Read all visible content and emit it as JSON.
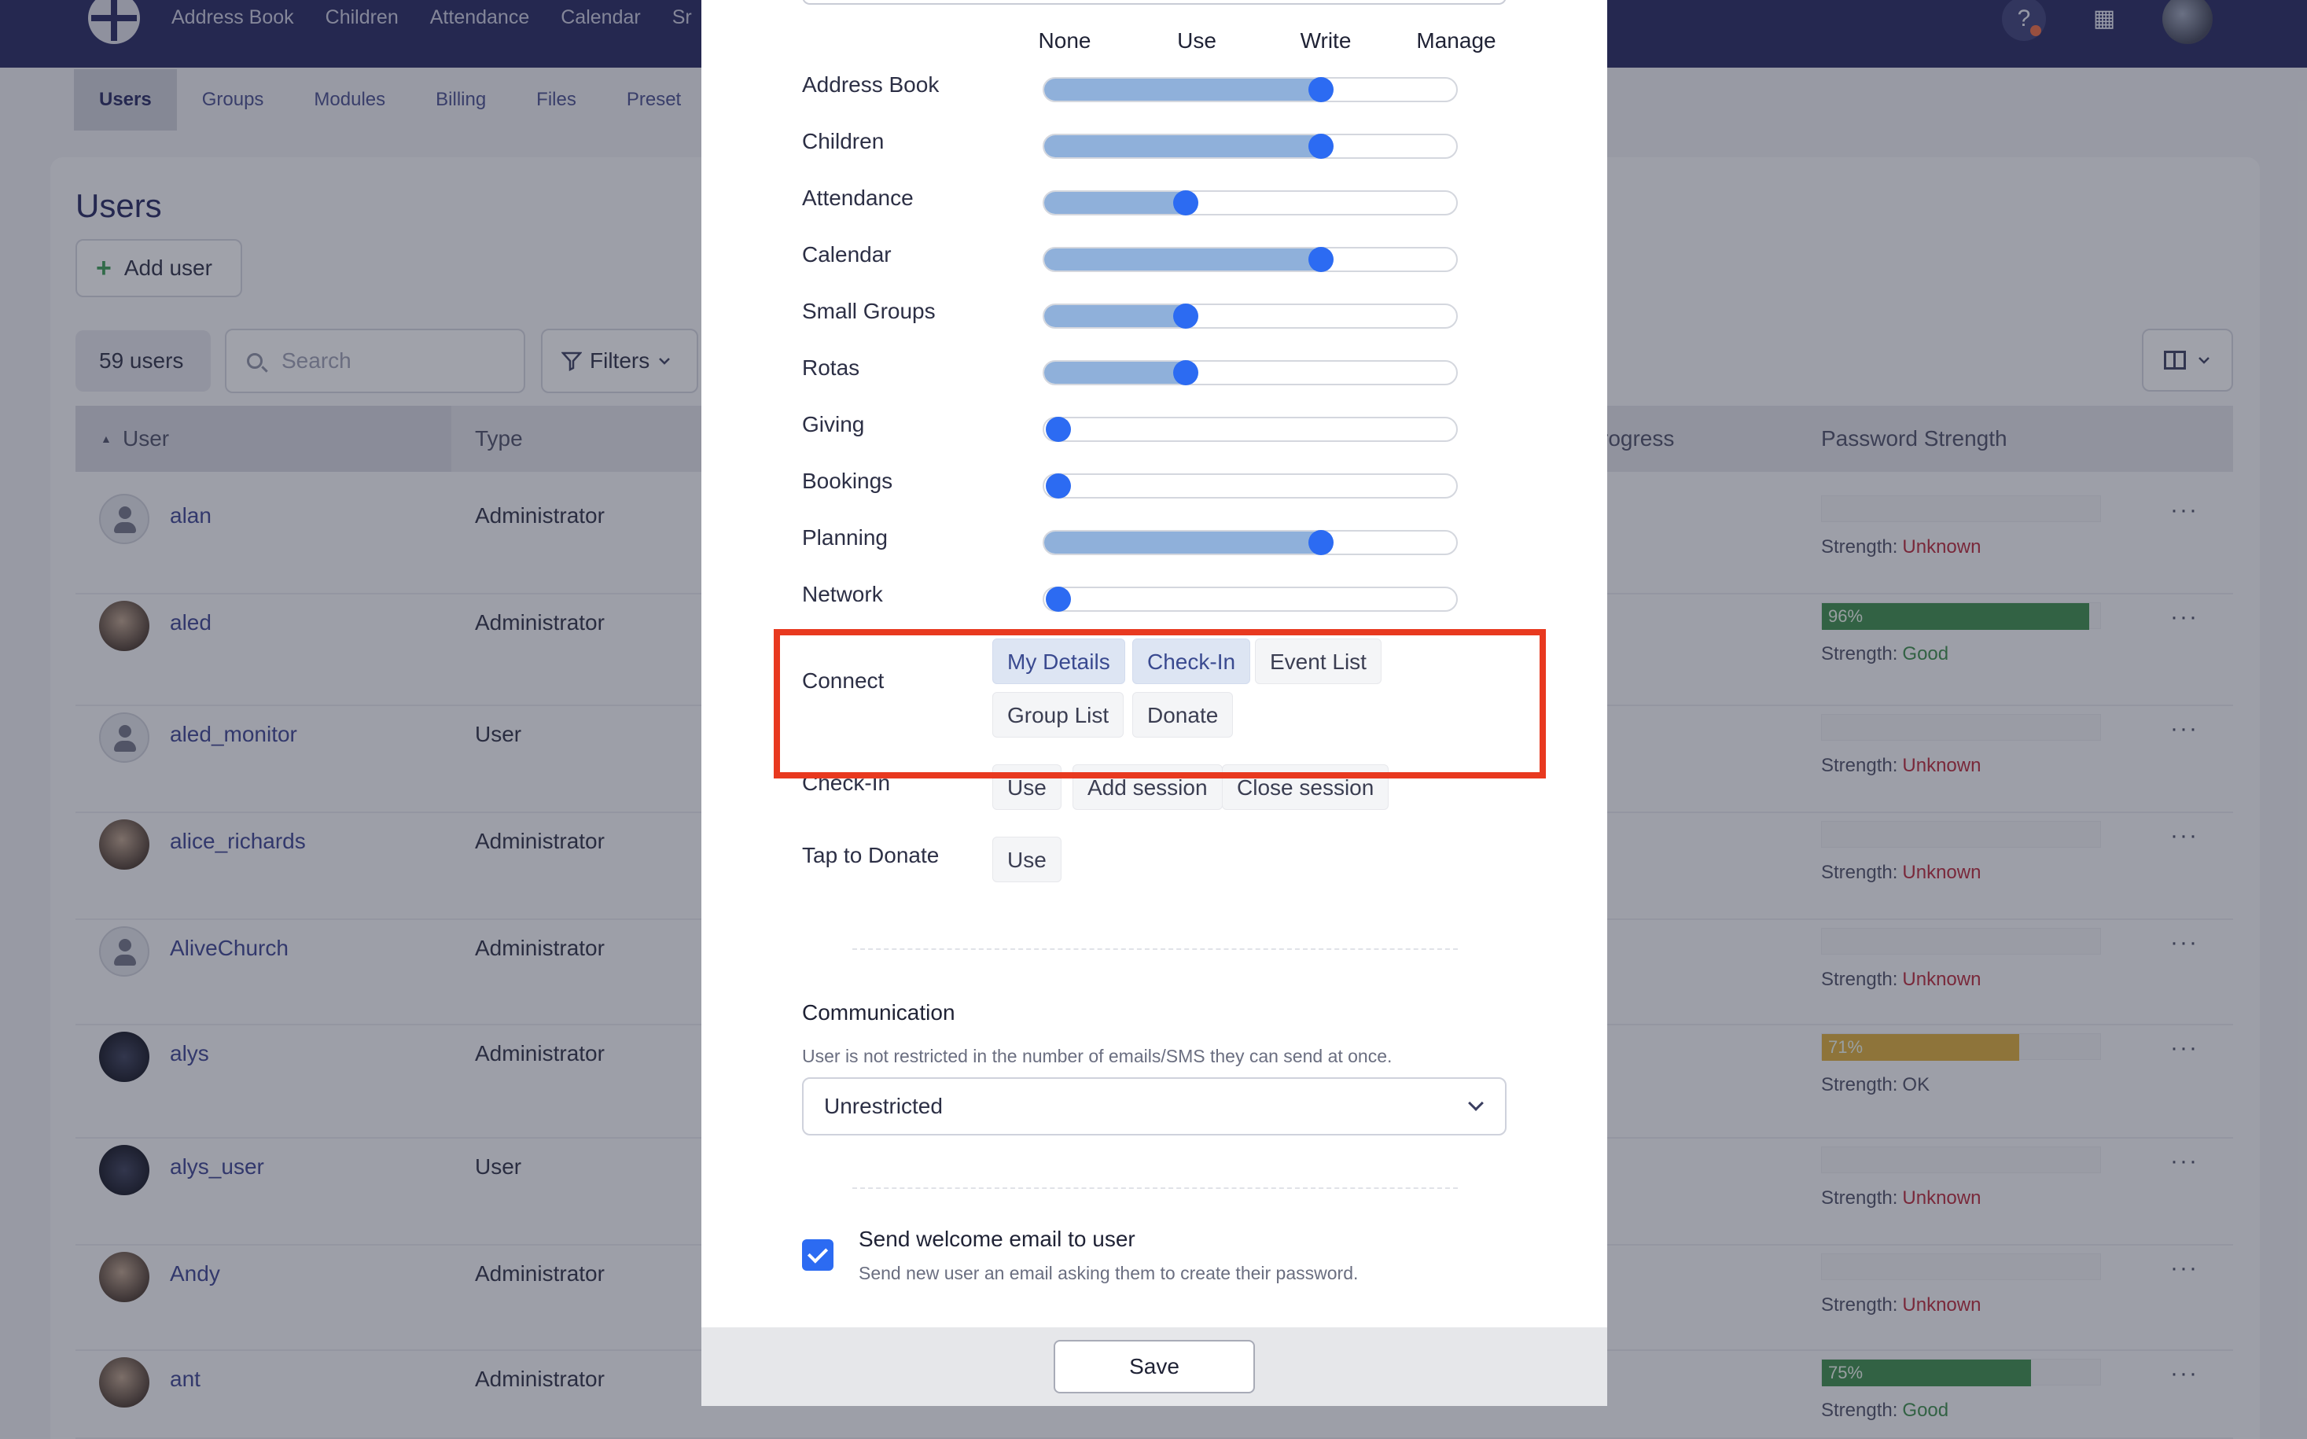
{
  "topnav": {
    "items": [
      "Address Book",
      "Children",
      "Attendance",
      "Calendar",
      "Sr"
    ]
  },
  "subtabs": [
    "Users",
    "Groups",
    "Modules",
    "Billing",
    "Files",
    "Preset"
  ],
  "page": {
    "title": "Users",
    "add_user_label": "Add user",
    "users_count": "59 users",
    "search_placeholder": "Search",
    "filters_label": "Filters"
  },
  "table": {
    "headers": {
      "user": "User",
      "type": "Type",
      "progress_partial": "rogress",
      "password_strength": "Password Strength"
    },
    "rows": [
      {
        "name": "alan",
        "type": "Administrator",
        "strength_prefix": "Strength:",
        "strength": "Unknown",
        "strength_color": "#b3273a",
        "pw_percent": "",
        "pw_fraction": 0
      },
      {
        "name": "aled",
        "type": "Administrator",
        "strength_prefix": "Strength:",
        "strength": "Good",
        "strength_color": "#3a8a4a",
        "pw_percent": "96%",
        "pw_fraction": 0.96
      },
      {
        "name": "aled_monitor",
        "type": "User",
        "strength_prefix": "Strength:",
        "strength": "Unknown",
        "strength_color": "#b3273a",
        "pw_percent": "",
        "pw_fraction": 0
      },
      {
        "name": "alice_richards",
        "type": "Administrator",
        "strength_prefix": "Strength:",
        "strength": "Unknown",
        "strength_color": "#b3273a",
        "pw_percent": "",
        "pw_fraction": 0
      },
      {
        "name": "AliveChurch",
        "type": "Administrator",
        "strength_prefix": "Strength:",
        "strength": "Unknown",
        "strength_color": "#b3273a",
        "pw_percent": "",
        "pw_fraction": 0
      },
      {
        "name": "alys",
        "type": "Administrator",
        "strength_prefix": "Strength:",
        "strength": "OK",
        "strength_color": "#4a4e66",
        "pw_percent": "71%",
        "pw_fraction": 0.71
      },
      {
        "name": "alys_user",
        "type": "User",
        "strength_prefix": "Strength:",
        "strength": "Unknown",
        "strength_color": "#b3273a",
        "pw_percent": "",
        "pw_fraction": 0
      },
      {
        "name": "Andy",
        "type": "Administrator",
        "strength_prefix": "Strength:",
        "strength": "Unknown",
        "strength_color": "#b3273a",
        "pw_percent": "",
        "pw_fraction": 0
      },
      {
        "name": "ant",
        "type": "Administrator",
        "strength_prefix": "Strength:",
        "strength": "Good",
        "strength_color": "#3a8a4a",
        "pw_percent": "75%",
        "pw_fraction": 0.75
      }
    ]
  },
  "modal": {
    "levels": [
      "None",
      "Use",
      "Write",
      "Manage"
    ],
    "permissions": [
      {
        "label": "Address Book",
        "level": 2
      },
      {
        "label": "Children",
        "level": 2
      },
      {
        "label": "Attendance",
        "level": 1
      },
      {
        "label": "Calendar",
        "level": 2
      },
      {
        "label": "Small Groups",
        "level": 1
      },
      {
        "label": "Rotas",
        "level": 1
      },
      {
        "label": "Giving",
        "level": 0
      },
      {
        "label": "Bookings",
        "level": 0
      },
      {
        "label": "Planning",
        "level": 2
      },
      {
        "label": "Network",
        "level": 0
      }
    ],
    "connect": {
      "label": "Connect",
      "chips": [
        {
          "label": "My Details",
          "selected": true
        },
        {
          "label": "Check-In",
          "selected": true
        },
        {
          "label": "Event List",
          "selected": false
        },
        {
          "label": "Group List",
          "selected": false
        },
        {
          "label": "Donate",
          "selected": false
        }
      ]
    },
    "checkin": {
      "label": "Check-In",
      "chips": [
        "Use",
        "Add session",
        "Close session"
      ]
    },
    "tap_to_donate": {
      "label": "Tap to Donate",
      "chips": [
        "Use"
      ]
    },
    "communication": {
      "title": "Communication",
      "description": "User is not restricted in the number of emails/SMS they can send at once.",
      "selected": "Unrestricted"
    },
    "welcome": {
      "label": "Send welcome email to user",
      "description": "Send new user an email asking them to create their password.",
      "checked": true
    },
    "save_label": "Save"
  },
  "colors": {
    "nav_bg": "#232760",
    "accent": "#2c6bf2",
    "slider_fill": "#8fb0da",
    "highlight_box": "#e8391f",
    "strength_good_bar": "#3a8a4a",
    "strength_ok_bar": "#d8a93a"
  },
  "icons": {
    "logo": "globe-logo",
    "help": "help-icon",
    "building": "building-icon",
    "avatar": "user-avatar",
    "search": "search-icon",
    "filter": "filter-icon",
    "columns": "columns-icon",
    "more": "more-icon",
    "chevron": "chevron-down-icon",
    "check": "checkmark-icon"
  }
}
